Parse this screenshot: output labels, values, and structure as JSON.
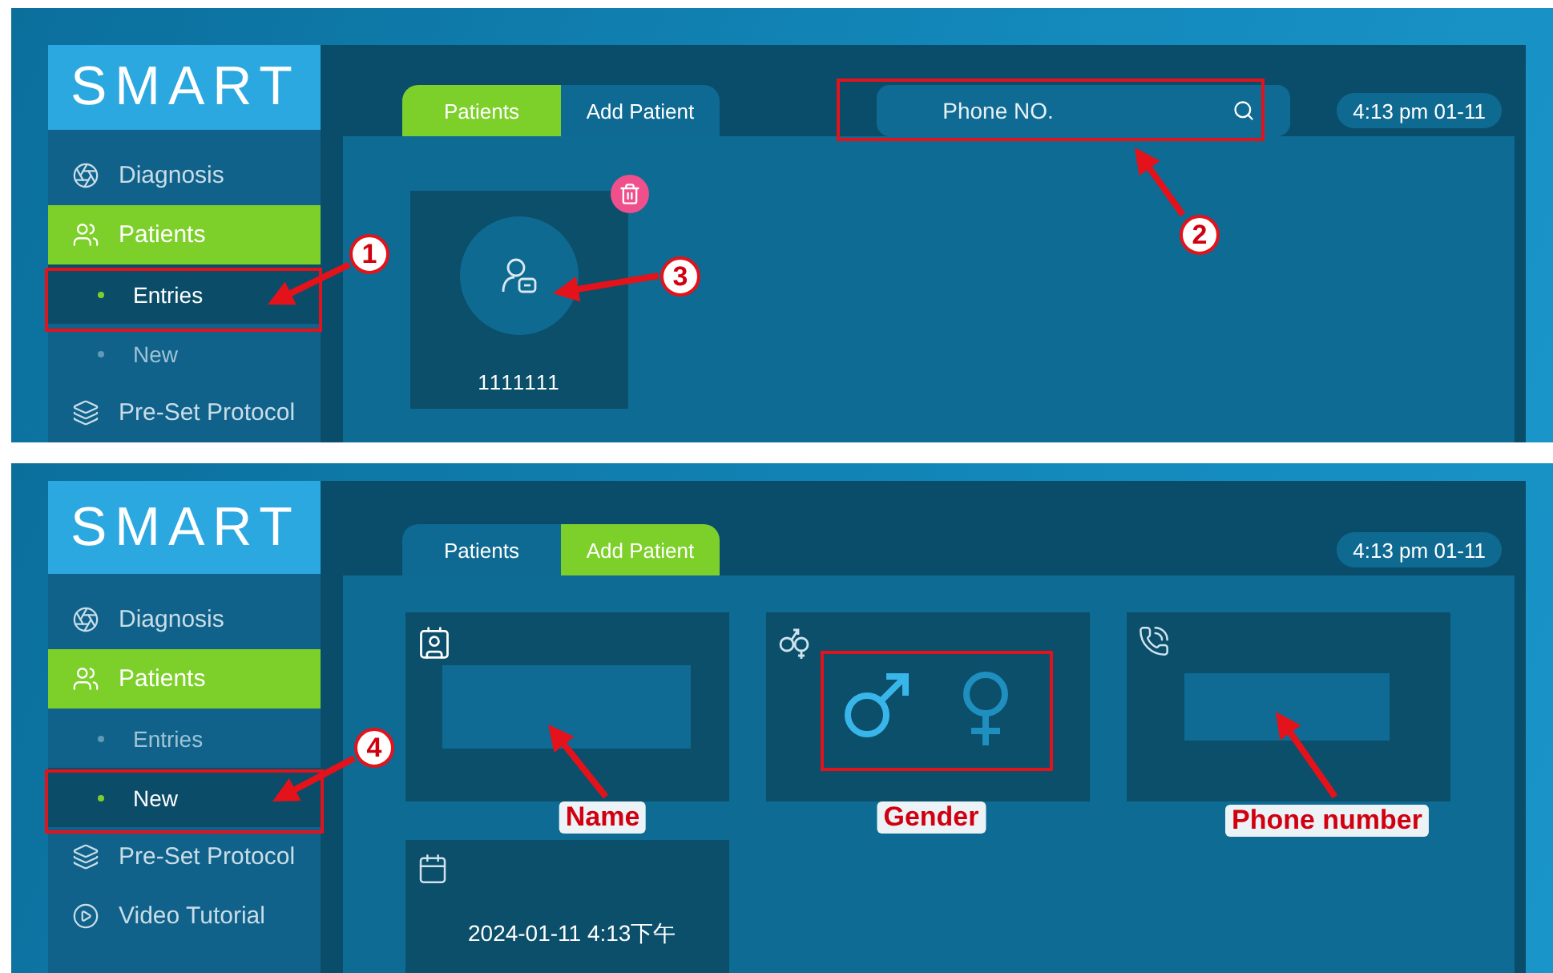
{
  "screens": [
    {
      "logo": "SMART",
      "nav": [
        {
          "label": "Diagnosis",
          "selected": false
        },
        {
          "label": "Patients",
          "selected": true,
          "children": [
            {
              "label": "Entries",
              "selected": true
            },
            {
              "label": "New",
              "selected": false
            }
          ]
        },
        {
          "label": "Pre-Set Protocol",
          "selected": false
        }
      ],
      "tabs": [
        {
          "label": "Patients",
          "selected": true
        },
        {
          "label": "Add Patient",
          "selected": false
        }
      ],
      "search": {
        "placeholder": "Phone NO."
      },
      "clock": "4:13 pm 01-11",
      "content": {
        "kind": "list",
        "patients": [
          {
            "id": "1111111"
          }
        ]
      },
      "callouts": [
        {
          "number": "1"
        },
        {
          "number": "2"
        },
        {
          "number": "3"
        }
      ]
    },
    {
      "logo": "SMART",
      "nav": [
        {
          "label": "Diagnosis",
          "selected": false
        },
        {
          "label": "Patients",
          "selected": true,
          "children": [
            {
              "label": "Entries",
              "selected": false
            },
            {
              "label": "New",
              "selected": true
            }
          ]
        },
        {
          "label": "Pre-Set Protocol",
          "selected": false
        },
        {
          "label": "Video Tutorial",
          "selected": false
        }
      ],
      "tabs": [
        {
          "label": "Patients",
          "selected": false
        },
        {
          "label": "Add Patient",
          "selected": true
        }
      ],
      "clock": "4:13 pm 01-11",
      "content": {
        "kind": "form",
        "fields": [
          {
            "kind": "name"
          },
          {
            "kind": "gender",
            "options": [
              {
                "kind": "male",
                "selected": true
              },
              {
                "kind": "female",
                "selected": false
              }
            ]
          },
          {
            "kind": "phone"
          },
          {
            "kind": "date",
            "value": "2024-01-11 4:13下午"
          }
        ]
      },
      "callouts": [
        {
          "number": "4"
        }
      ],
      "labels": [
        {
          "text": "Name"
        },
        {
          "text": "Gender"
        },
        {
          "text": "Phone number"
        }
      ]
    }
  ]
}
